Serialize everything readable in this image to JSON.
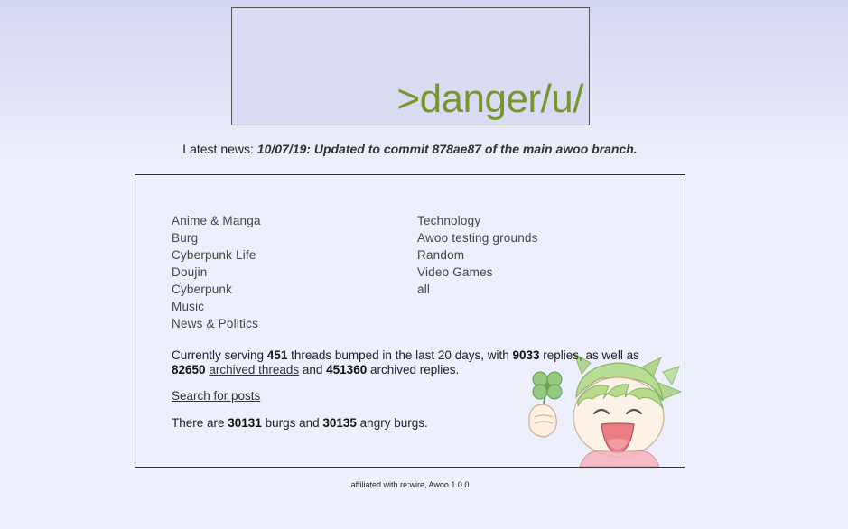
{
  "banner": {
    "text": ">danger/u/"
  },
  "news": {
    "label": "Latest news:",
    "body": "10/07/19: Updated to commit 878ae87 of the main awoo branch."
  },
  "boards": {
    "left": [
      "Anime & Manga",
      "Burg",
      "Cyberpunk Life",
      "Doujin",
      "Cyberpunk",
      "Music",
      "News & Politics"
    ],
    "right": [
      "Technology",
      "Awoo testing grounds",
      "Random",
      "Video Games",
      "all"
    ]
  },
  "stats": {
    "t1": "Currently serving ",
    "threads": "451",
    "t2": " threads bumped in the last 20 days, with ",
    "replies": "9033",
    "t3": " replies, as well as ",
    "archived_threads_count": "82650",
    "t4": " ",
    "archived_threads_link": "archived threads",
    "t5": " and ",
    "archived_replies": "451360",
    "t6": " archived replies."
  },
  "search": {
    "link": "Search for posts"
  },
  "burgs": {
    "t1": "There are ",
    "burgs": "30131",
    "t2": " burgs and ",
    "angry": "30135",
    "t3": " angry burgs."
  },
  "footer": {
    "text": "affiliated with re:wire, Awoo 1.0.0"
  },
  "mascot": {
    "icon": "yotsuba-clover-mascot-icon",
    "hair_color": "#9fcf72",
    "clover_color": "#8fc97a"
  }
}
